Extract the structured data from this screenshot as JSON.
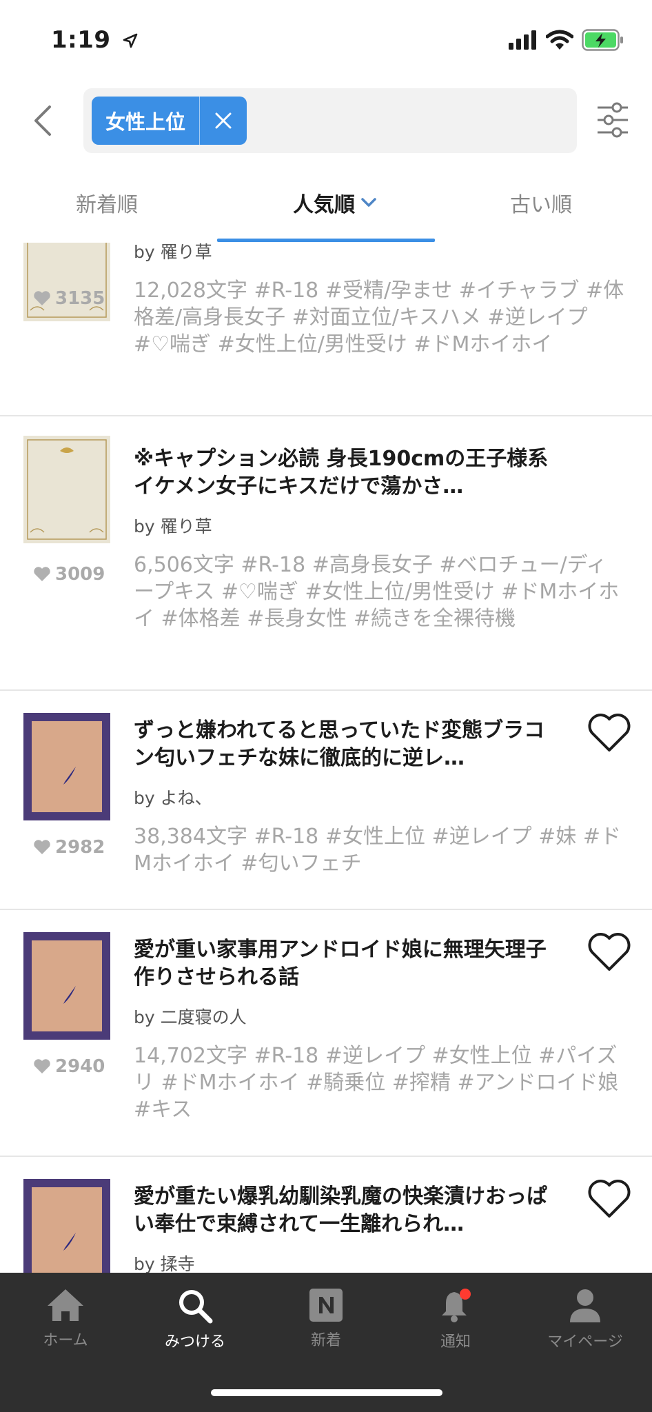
{
  "status_bar": {
    "time": "1:19"
  },
  "search": {
    "tag": "女性上位"
  },
  "sort_tabs": [
    {
      "label": "新着順"
    },
    {
      "label": "人気順"
    },
    {
      "label": "古い順"
    }
  ],
  "items": [
    {
      "title": "",
      "author": "by 罹り草",
      "likes": "3135",
      "meta": "12,028文字 #R-18 #受精/孕ませ #イチャラブ #体格差/高身長女子 #対面立位/キスハメ #逆レイプ #♡喘ぎ #女性上位/男性受け #ドMホイホイ"
    },
    {
      "title": "※キャプション必読 身長190cmの王子様系イケメン女子にキスだけで蕩かさ…",
      "author": "by 罹り草",
      "likes": "3009",
      "meta": "6,506文字 #R-18 #高身長女子 #ベロチュー/ディープキス #♡喘ぎ #女性上位/男性受け #ドMホイホイ #体格差 #長身女性 #続きを全裸待機"
    },
    {
      "title": "ずっと嫌われてると思っていたド変態ブラコン匂いフェチな妹に徹底的に逆レ…",
      "author": "by よね、",
      "likes": "2982",
      "meta": "38,384文字 #R-18 #女性上位 #逆レイプ #妹 #ドMホイホイ #匂いフェチ"
    },
    {
      "title": "愛が重い家事用アンドロイド娘に無理矢理子作りさせられる話",
      "author": "by 二度寝の人",
      "likes": "2940",
      "meta": "14,702文字 #R-18 #逆レイプ #女性上位 #パイズリ #ドMホイホイ #騎乗位 #搾精 #アンドロイド娘 #キス"
    },
    {
      "title": "愛が重たい爆乳幼馴染乳魔の快楽漬けおっぱい奉仕で束縛されて一生離れられ…",
      "author": "by 揉寺",
      "likes": "",
      "meta": ""
    }
  ],
  "tabbar": [
    {
      "label": "ホーム",
      "icon": "house-icon"
    },
    {
      "label": "みつける",
      "icon": "search-icon"
    },
    {
      "label": "新着",
      "icon": "n-badge-icon"
    },
    {
      "label": "通知",
      "icon": "bell-icon"
    },
    {
      "label": "マイページ",
      "icon": "person-icon"
    }
  ],
  "colors": {
    "accent": "#3b8fe5",
    "tabbar_bg": "#2f2f2f",
    "battery": "#4cd964",
    "notification_dot": "#ff3b30"
  }
}
